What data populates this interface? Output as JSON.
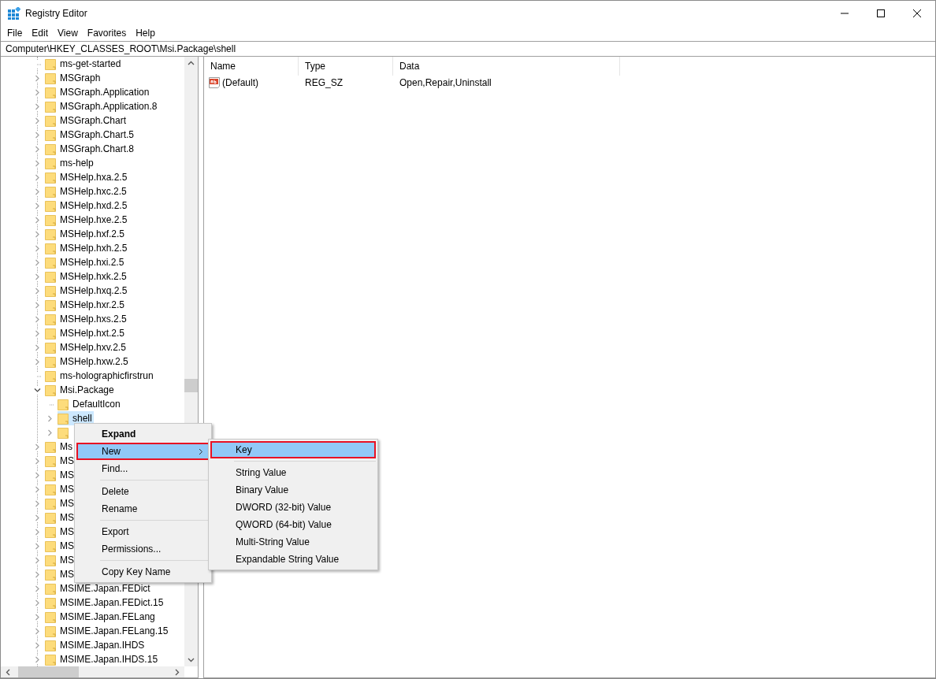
{
  "window": {
    "title": "Registry Editor"
  },
  "menu_bar": [
    "File",
    "Edit",
    "View",
    "Favorites",
    "Help"
  ],
  "address_bar": {
    "value": "Computer\\HKEY_CLASSES_ROOT\\Msi.Package\\shell"
  },
  "tree": {
    "items": [
      {
        "label": "ms-get-started",
        "kind": "leaf",
        "selected": false
      },
      {
        "label": "MSGraph",
        "kind": "branch",
        "expanded": false,
        "selected": false
      },
      {
        "label": "MSGraph.Application",
        "kind": "branch",
        "expanded": false,
        "selected": false
      },
      {
        "label": "MSGraph.Application.8",
        "kind": "branch",
        "expanded": false,
        "selected": false
      },
      {
        "label": "MSGraph.Chart",
        "kind": "branch",
        "expanded": false,
        "selected": false
      },
      {
        "label": "MSGraph.Chart.5",
        "kind": "branch",
        "expanded": false,
        "selected": false
      },
      {
        "label": "MSGraph.Chart.8",
        "kind": "branch",
        "expanded": false,
        "selected": false
      },
      {
        "label": "ms-help",
        "kind": "branch",
        "expanded": false,
        "selected": false
      },
      {
        "label": "MSHelp.hxa.2.5",
        "kind": "branch",
        "expanded": false,
        "selected": false
      },
      {
        "label": "MSHelp.hxc.2.5",
        "kind": "branch",
        "expanded": false,
        "selected": false
      },
      {
        "label": "MSHelp.hxd.2.5",
        "kind": "branch",
        "expanded": false,
        "selected": false
      },
      {
        "label": "MSHelp.hxe.2.5",
        "kind": "branch",
        "expanded": false,
        "selected": false
      },
      {
        "label": "MSHelp.hxf.2.5",
        "kind": "branch",
        "expanded": false,
        "selected": false
      },
      {
        "label": "MSHelp.hxh.2.5",
        "kind": "branch",
        "expanded": false,
        "selected": false
      },
      {
        "label": "MSHelp.hxi.2.5",
        "kind": "branch",
        "expanded": false,
        "selected": false
      },
      {
        "label": "MSHelp.hxk.2.5",
        "kind": "branch",
        "expanded": false,
        "selected": false
      },
      {
        "label": "MSHelp.hxq.2.5",
        "kind": "branch",
        "expanded": false,
        "selected": false
      },
      {
        "label": "MSHelp.hxr.2.5",
        "kind": "branch",
        "expanded": false,
        "selected": false
      },
      {
        "label": "MSHelp.hxs.2.5",
        "kind": "branch",
        "expanded": false,
        "selected": false
      },
      {
        "label": "MSHelp.hxt.2.5",
        "kind": "branch",
        "expanded": false,
        "selected": false
      },
      {
        "label": "MSHelp.hxv.2.5",
        "kind": "branch",
        "expanded": false,
        "selected": false
      },
      {
        "label": "MSHelp.hxw.2.5",
        "kind": "branch",
        "expanded": false,
        "selected": false
      },
      {
        "label": "ms-holographicfirstrun",
        "kind": "leaf",
        "selected": false
      },
      {
        "label": "Msi.Package",
        "kind": "branch",
        "expanded": true,
        "selected": false,
        "children": [
          {
            "label": "DefaultIcon",
            "kind": "leaf",
            "selected": false
          },
          {
            "label": "shell",
            "kind": "branch",
            "expanded": false,
            "selected": true
          },
          {
            "kind": "branch",
            "expanded": false,
            "selected": false
          }
        ]
      },
      {
        "label": "Ms",
        "kind": "branch",
        "expanded": false,
        "selected": false
      },
      {
        "label": "MS",
        "kind": "branch",
        "expanded": false,
        "selected": false
      },
      {
        "label": "MS",
        "kind": "branch",
        "expanded": false,
        "selected": false
      },
      {
        "label": "MS",
        "kind": "branch",
        "expanded": false,
        "selected": false
      },
      {
        "label": "MS",
        "kind": "branch",
        "expanded": false,
        "selected": false
      },
      {
        "label": "MS",
        "kind": "branch",
        "expanded": false,
        "selected": false
      },
      {
        "label": "MS",
        "kind": "branch",
        "expanded": false,
        "selected": false
      },
      {
        "label": "MS",
        "kind": "branch",
        "expanded": false,
        "selected": false
      },
      {
        "label": "MS",
        "kind": "branch",
        "expanded": false,
        "selected": false
      },
      {
        "label": "MS",
        "kind": "branch",
        "expanded": false,
        "selected": false
      },
      {
        "label": "MSIME.Japan.FEDict",
        "kind": "branch",
        "expanded": false,
        "selected": false
      },
      {
        "label": "MSIME.Japan.FEDict.15",
        "kind": "branch",
        "expanded": false,
        "selected": false
      },
      {
        "label": "MSIME.Japan.FELang",
        "kind": "branch",
        "expanded": false,
        "selected": false
      },
      {
        "label": "MSIME.Japan.FELang.15",
        "kind": "branch",
        "expanded": false,
        "selected": false
      },
      {
        "label": "MSIME.Japan.IHDS",
        "kind": "branch",
        "expanded": false,
        "selected": false
      },
      {
        "label": "MSIME.Japan.IHDS.15",
        "kind": "branch",
        "expanded": false,
        "selected": false
      }
    ]
  },
  "values_table": {
    "columns": [
      "Name",
      "Type",
      "Data"
    ],
    "rows": [
      {
        "name": "(Default)",
        "type": "REG_SZ",
        "data": "Open,Repair,Uninstall"
      }
    ]
  },
  "context_menu": {
    "items": [
      {
        "kind": "item",
        "label": "Expand",
        "default": true,
        "selected": false,
        "submenu": false
      },
      {
        "kind": "item",
        "label": "New",
        "default": false,
        "selected": true,
        "submenu": true
      },
      {
        "kind": "item",
        "label": "Find...",
        "default": false,
        "selected": false,
        "submenu": false
      },
      {
        "kind": "separator"
      },
      {
        "kind": "item",
        "label": "Delete",
        "default": false,
        "selected": false,
        "submenu": false
      },
      {
        "kind": "item",
        "label": "Rename",
        "default": false,
        "selected": false,
        "submenu": false
      },
      {
        "kind": "separator"
      },
      {
        "kind": "item",
        "label": "Export",
        "default": false,
        "selected": false,
        "submenu": false
      },
      {
        "kind": "item",
        "label": "Permissions...",
        "default": false,
        "selected": false,
        "submenu": false
      },
      {
        "kind": "separator"
      },
      {
        "kind": "item",
        "label": "Copy Key Name",
        "default": false,
        "selected": false,
        "submenu": false
      }
    ]
  },
  "submenu": {
    "items": [
      {
        "kind": "item",
        "label": "Key",
        "selected": true
      },
      {
        "kind": "separator"
      },
      {
        "kind": "item",
        "label": "String Value",
        "selected": false
      },
      {
        "kind": "item",
        "label": "Binary Value",
        "selected": false
      },
      {
        "kind": "item",
        "label": "DWORD (32-bit) Value",
        "selected": false
      },
      {
        "kind": "item",
        "label": "QWORD (64-bit) Value",
        "selected": false
      },
      {
        "kind": "item",
        "label": "Multi-String Value",
        "selected": false
      },
      {
        "kind": "item",
        "label": "Expandable String Value",
        "selected": false
      }
    ]
  }
}
